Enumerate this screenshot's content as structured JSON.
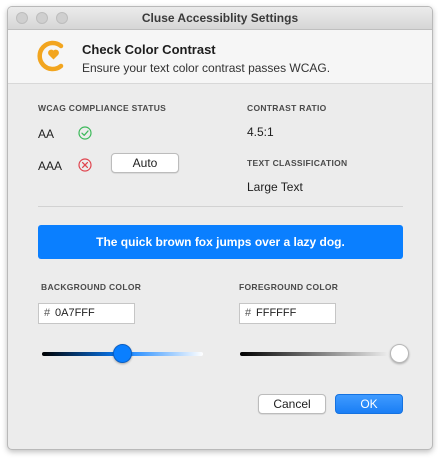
{
  "window": {
    "title": "Cluse Accessiblity Settings"
  },
  "header": {
    "title": "Check Color Contrast",
    "subtitle": "Ensure your text color contrast passes WCAG."
  },
  "compliance": {
    "label": "WCAG COMPLIANCE STATUS",
    "levels": [
      {
        "name": "AA",
        "status": "pass",
        "icon": "check-circle-icon"
      },
      {
        "name": "AAA",
        "status": "fail",
        "icon": "x-circle-icon"
      }
    ],
    "auto_button": "Auto"
  },
  "contrast": {
    "label": "CONTRAST RATIO",
    "value": "4.5:1"
  },
  "classification": {
    "label": "TEXT CLASSIFICATION",
    "value": "Large Text"
  },
  "preview": {
    "text": "The quick brown fox jumps over a lazy dog.",
    "background": "#0A7FFF",
    "foreground": "#FFFFFF"
  },
  "background_color": {
    "label": "BACKGROUND COLOR",
    "hash": "#",
    "value": "0A7FFF",
    "slider_fraction": 0.5
  },
  "foreground_color": {
    "label": "FOREGROUND COLOR",
    "hash": "#",
    "value": "FFFFFF",
    "slider_fraction": 1.0
  },
  "buttons": {
    "cancel": "Cancel",
    "ok": "OK"
  },
  "colors": {
    "accent": "#0A7FFF",
    "pass": "#3cb95a",
    "fail": "#e0454f",
    "logo": "#f2a51f"
  }
}
